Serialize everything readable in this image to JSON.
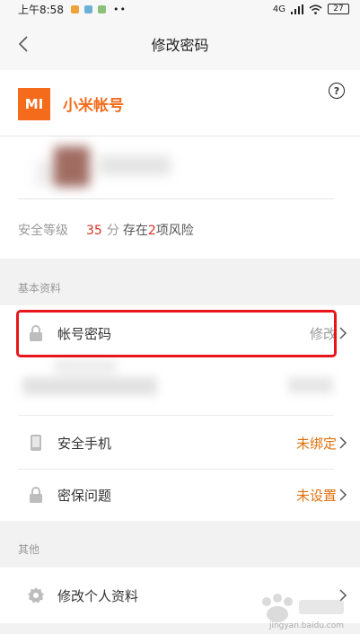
{
  "status_bar": {
    "time": "上午8:58",
    "battery": "27",
    "network": "4G"
  },
  "nav": {
    "title": "修改密码"
  },
  "account": {
    "logo_text": "MI",
    "title": "小米帐号",
    "help_symbol": "?"
  },
  "security": {
    "label": "安全等级",
    "score": "35",
    "unit": "分",
    "risk_prefix": "存在",
    "risk_count": "2",
    "risk_suffix": "项风险"
  },
  "sections": {
    "basic": "基本资料",
    "other": "其他"
  },
  "basic_items": [
    {
      "label": "帐号密码",
      "value": "修改"
    },
    {
      "label": "安全手机",
      "value": "未绑定"
    },
    {
      "label": "密保问题",
      "value": "未设置"
    }
  ],
  "other_items": [
    {
      "label": "修改个人资料",
      "value": ""
    }
  ],
  "colors": {
    "brand": "#f56b1c",
    "warning": "#e0720f",
    "danger": "#d63228",
    "highlight": "#e8161c"
  },
  "watermark": {
    "text": "jingyan.baidu.com"
  }
}
